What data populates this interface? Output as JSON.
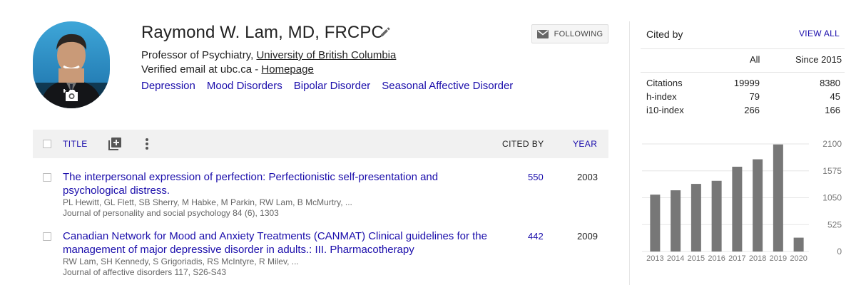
{
  "profile": {
    "name": "Raymond W. Lam, MD, FRCPC",
    "affiliation_prefix": "Professor of Psychiatry, ",
    "affiliation_link": "University of British Columbia",
    "email_prefix": "Verified email at ubc.ca - ",
    "homepage_link": "Homepage",
    "interests": [
      "Depression",
      "Mood Disorders",
      "Bipolar Disorder",
      "Seasonal Affective Disorder"
    ],
    "follow_label": "FOLLOWING"
  },
  "table": {
    "col_title": "TITLE",
    "col_cited": "CITED BY",
    "col_year": "YEAR"
  },
  "articles": [
    {
      "title": "The interpersonal expression of perfection: Perfectionistic self-presentation and psychological distress.",
      "authors": "PL Hewitt, GL Flett, SB Sherry, M Habke, M Parkin, RW Lam, B McMurtry, ...",
      "journal": "Journal of personality and social psychology 84 (6), 1303",
      "cited_by": "550",
      "year": "2003"
    },
    {
      "title": "Canadian Network for Mood and Anxiety Treatments (CANMAT) Clinical guidelines for the management of major depressive disorder in adults.: III. Pharmacotherapy",
      "authors": "RW Lam, SH Kennedy, S Grigoriadis, RS McIntyre, R Milev, ...",
      "journal": "Journal of affective disorders 117, S26-S43",
      "cited_by": "442",
      "year": "2009"
    }
  ],
  "sidebar": {
    "cited_by_label": "Cited by",
    "view_all_label": "VIEW ALL",
    "col_all": "All",
    "col_since": "Since 2015",
    "stats": [
      {
        "label": "Citations",
        "all": "19999",
        "since": "8380"
      },
      {
        "label": "h-index",
        "all": "79",
        "since": "45"
      },
      {
        "label": "i10-index",
        "all": "266",
        "since": "166"
      }
    ]
  },
  "colors": {
    "link": "#1a0dab",
    "bar": "#777777"
  },
  "icons": [
    "camera-icon",
    "edit-pencil-icon",
    "mail-icon",
    "add-to-list-icon",
    "more-vert-icon"
  ],
  "chart_data": {
    "type": "bar",
    "categories": [
      "2013",
      "2014",
      "2015",
      "2016",
      "2017",
      "2018",
      "2019",
      "2020"
    ],
    "values": [
      1110,
      1195,
      1320,
      1380,
      1655,
      1800,
      2090,
      270
    ],
    "yticks": [
      "2100",
      "1575",
      "1050",
      "525",
      "0"
    ],
    "ylim": [
      0,
      2100
    ],
    "grid": true
  }
}
